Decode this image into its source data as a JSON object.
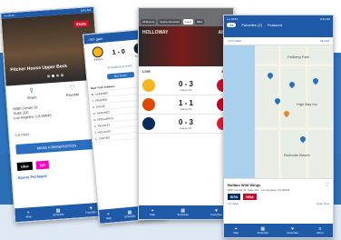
{
  "phone1": {
    "status_left": "•••• AT&T",
    "status_time": "9:41 AM",
    "brand": "Stubs",
    "venue": "Pitcher House Upper Beck",
    "share": "Share",
    "favorite": "Favorite",
    "address1": "5080 Center St.",
    "address2": "Suite 110",
    "address3": "Los Angeles, CA 90045",
    "rating": "0.8 miles",
    "reserve": "MAKE A RESERVATION",
    "logos": [
      "Uber",
      "lyft"
    ],
    "packages": "Sports Packages",
    "tabs": [
      "Map",
      "Schedule",
      "Favorites"
    ]
  },
  "phone2": {
    "header": "NY gam",
    "teamA": "Pirates",
    "teamB": "Yankees",
    "score": "1 - 0",
    "find": "Find places to watch",
    "pill": "Box Score",
    "lineup_title": "New York Yankees",
    "lineup": [
      {
        "name": "B. GARDNER",
        "stat": "0"
      },
      {
        "name": "C. FRAZIER",
        "stat": "1"
      },
      {
        "name": "A. JUDGE",
        "stat": "0"
      },
      {
        "name": "G. SANCHEZ",
        "stat": "0"
      },
      {
        "name": "D. GREGORIUS",
        "stat": "0"
      },
      {
        "name": "C. HEADLEY",
        "stat": "1"
      },
      {
        "name": "T. HOLLIDAY",
        "stat": "0"
      },
      {
        "name": "C. CARTER",
        "stat": "0"
      }
    ],
    "tabs": [
      "Map",
      "Schedule",
      "Favorites"
    ]
  },
  "phone3": {
    "chips": [
      "All Events",
      "Venue Favorites",
      "Food",
      "NBA",
      "MLB"
    ],
    "promo_left": "HOLLOWAY",
    "promo_right": "AIDO",
    "live_label": "LIVE",
    "live_action": "MLB",
    "games": [
      {
        "a": "Pirates",
        "b": "Nationals",
        "score": "0 - 3",
        "sub": "Game 1/2",
        "ca": "#f5b51b",
        "cb": "#c8102e"
      },
      {
        "a": "Orioles",
        "b": "Reds",
        "score": "1 - 1",
        "sub": "Game 4/4",
        "ca": "#df4601",
        "cb": "#c6011f"
      },
      {
        "a": "Rays",
        "b": "Indians",
        "score": "0 - 3",
        "sub": "Game 1/1",
        "ca": "#092c5c",
        "cb": "#e31937"
      }
    ],
    "tabs": [
      "Map",
      "Schedule",
      "Favorites"
    ]
  },
  "phone4": {
    "status_left": "•••• AT&T",
    "status_time": "9:41 AM",
    "tabs_top": [
      "All",
      "Favorites (2)",
      "Featured"
    ],
    "list": "LIST VIEW",
    "filter": "FILTER",
    "map_labels": [
      "Pallberg Park",
      "Redondo Beach",
      "High Bay Inn"
    ],
    "card_title": "Buffalo Wild Wings",
    "card_address": "5087 Center St. Suite 110 · Los Angeles, CA 90045",
    "card_logos": [
      "BTN",
      "NBA"
    ],
    "card_link": "Open Now",
    "card_distance": "1.6 miles",
    "tabs": [
      "Map",
      "Schedule",
      "Favorites",
      "Menu"
    ]
  }
}
